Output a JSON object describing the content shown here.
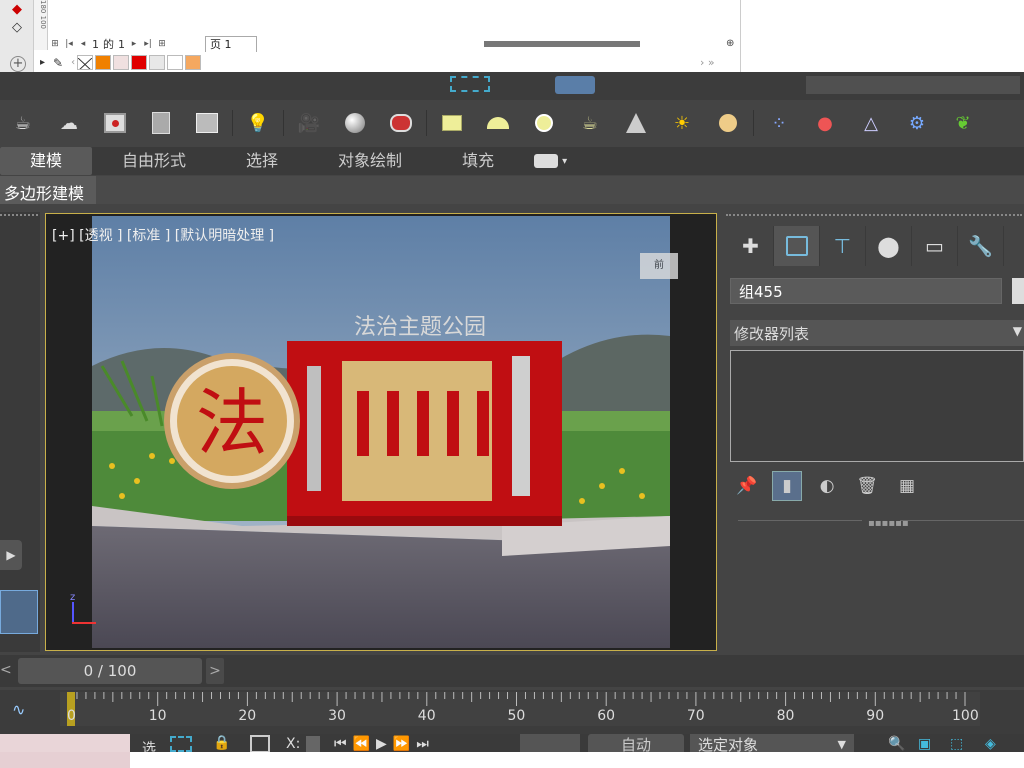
{
  "top_app": {
    "ruler_numbers": [
      "180",
      "100"
    ],
    "pager": {
      "current": "1",
      "of_label": "的",
      "total": "1"
    },
    "page_tab": "页 1"
  },
  "toolbar": {
    "icons": [
      "teapot-icon",
      "cloud-icon",
      "render-frame-icon",
      "render-setup-icon",
      "render-table-icon",
      "bulb-icon",
      "camera-icon",
      "material-sphere-icon",
      "material-editor-icon",
      "plane-icon",
      "dome-icon",
      "sphere-icon",
      "teapot-small-icon",
      "cone-icon",
      "sun-icon",
      "light-sphere-icon",
      "particles-icon",
      "molecule-icon",
      "tetra-icon",
      "gear-icon",
      "plant-icon"
    ]
  },
  "ribbon": {
    "tabs": [
      "建模",
      "自由形式",
      "选择",
      "对象绘制",
      "填充"
    ],
    "active": "建模",
    "sub_label": "多边形建模"
  },
  "viewport": {
    "label": "[+] [透视 ] [标准 ] [默认明暗处理 ]",
    "nav_cube_text": "前"
  },
  "command_panel": {
    "object_name": "组455",
    "modifier_list": "修改器列表"
  },
  "timeline": {
    "frame_display": "0 / 100",
    "prev": "<",
    "next": ">",
    "tick_labels": [
      "0",
      "10",
      "20",
      "30",
      "40",
      "50",
      "60",
      "70",
      "80",
      "90",
      "100"
    ]
  },
  "status": {
    "select_prefix": "选",
    "x_label": "X:",
    "auto_label": "自动",
    "selected_objects": "选定对象"
  },
  "colors": {
    "viewport_border": "#c8b04a",
    "time_cursor": "#b8a020",
    "sign_red": "#c00e12",
    "sign_gold": "#d8b878"
  }
}
